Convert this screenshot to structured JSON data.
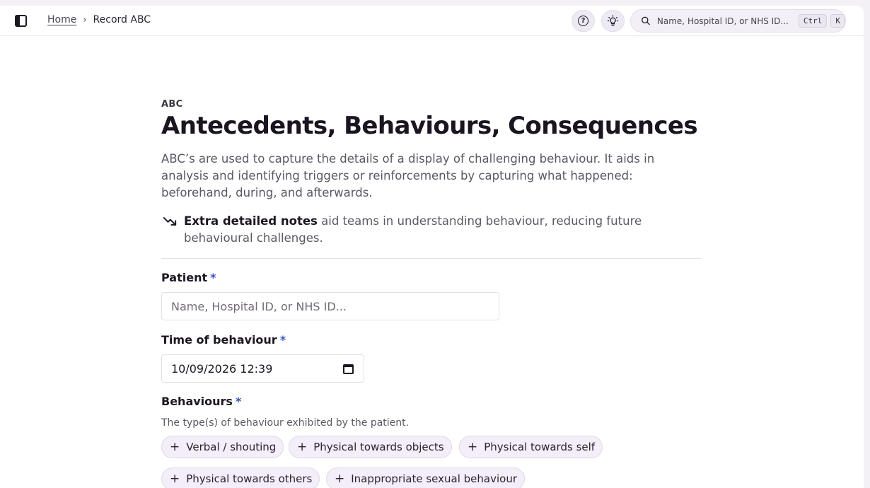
{
  "header": {
    "breadcrumb": {
      "home": "Home",
      "separator": "›",
      "current": "Record ABC"
    },
    "search": {
      "placeholder": "Name, Hospital ID, or NHS ID...",
      "shortcut_keys": [
        "Ctrl",
        "K"
      ]
    },
    "icons": [
      "sidebar-toggle-icon",
      "help-icon",
      "theme-toggle-icon",
      "search-icon"
    ]
  },
  "page": {
    "eyebrow": "ABC",
    "title": "Antecedents, Behaviours, Consequences",
    "description": "ABC’s are used to capture the details of a display of challenging behaviour. It aids in analysis and identifying triggers or reinforcements by capturing what happened: beforehand, during, and afterwards.",
    "note": {
      "strong": "Extra detailed notes",
      "rest": " aid teams in understanding behaviour, reducing future behavioural challenges."
    }
  },
  "form": {
    "patient": {
      "label": "Patient",
      "required_mark": "*",
      "placeholder": "Name, Hospital ID, or NHS ID..."
    },
    "time": {
      "label": "Time of behaviour",
      "required_mark": "*",
      "value": "10/09/2026 12:39"
    },
    "behaviours": {
      "label": "Behaviours",
      "required_mark": "*",
      "help": "The type(s) of behaviour exhibited by the patient.",
      "options": [
        "Verbal / shouting",
        "Physical towards objects",
        "Physical towards self",
        "Physical towards others",
        "Inappropriate sexual behaviour"
      ]
    }
  },
  "colors": {
    "accent": "#3b55c7",
    "chip_bg": "#f3eef8",
    "text": "#1c1722"
  }
}
